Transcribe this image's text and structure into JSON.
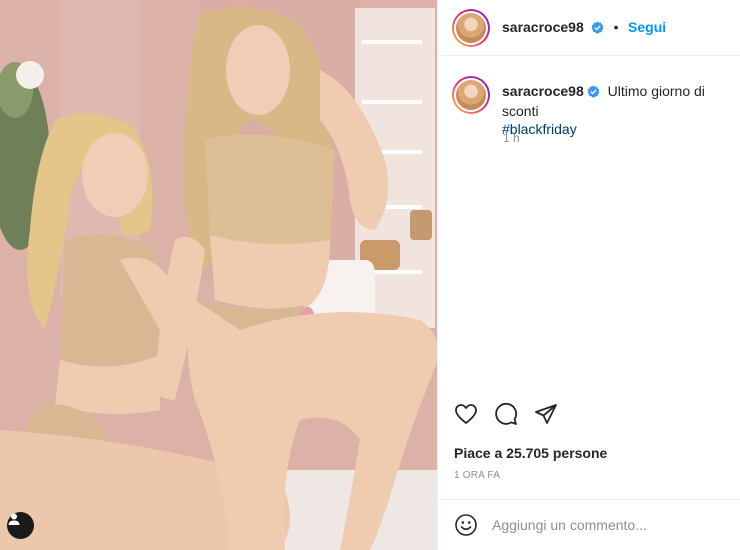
{
  "post": {
    "username": "saracroce98",
    "follow_label": "Segui",
    "separator": "•",
    "caption_text": "Ultimo giorno di sconti",
    "caption_hashtag": "#blackfriday",
    "caption_time": "1 h",
    "likes": "Piace a 25.705 persone",
    "time_ago": "1 ORA FA",
    "comment_placeholder": "Aggiungi un commento..."
  },
  "icons": {
    "verified": "verified-badge-icon",
    "like": "heart-icon",
    "comment": "comment-bubble-icon",
    "share": "paper-plane-icon",
    "emoji": "smiley-icon",
    "user_tag": "user-tag-icon"
  },
  "colors": {
    "accent": "#0095f6",
    "hashtag": "#00376b",
    "text": "#262626",
    "muted": "#8e8e8e"
  }
}
